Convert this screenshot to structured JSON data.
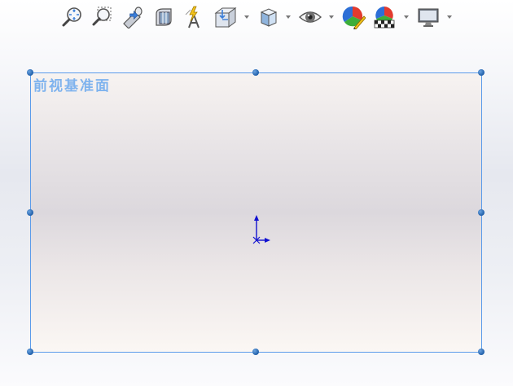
{
  "toolbar": {
    "items": [
      {
        "icon": "zoom-to-fit-icon",
        "has_dropdown": false
      },
      {
        "icon": "zoom-to-area-icon",
        "has_dropdown": false
      },
      {
        "icon": "previous-view-icon",
        "has_dropdown": false
      },
      {
        "icon": "section-view-icon",
        "has_dropdown": false
      },
      {
        "icon": "dynamic-annotation-views-icon",
        "has_dropdown": false
      },
      {
        "icon": "view-orientation-icon",
        "has_dropdown": true
      },
      {
        "icon": "display-style-icon",
        "has_dropdown": true
      },
      {
        "icon": "hide-show-items-icon",
        "has_dropdown": true
      },
      {
        "icon": "edit-appearance-icon",
        "has_dropdown": false
      },
      {
        "icon": "apply-scene-icon",
        "has_dropdown": true
      },
      {
        "icon": "view-settings-icon",
        "has_dropdown": true
      }
    ]
  },
  "viewport": {
    "plane_label": "前视基准面",
    "plane_border_color": "#5b9bea",
    "label_color": "#7fb3ee",
    "handle_color": "#1f5ea8",
    "origin_color": "#1010d0"
  }
}
